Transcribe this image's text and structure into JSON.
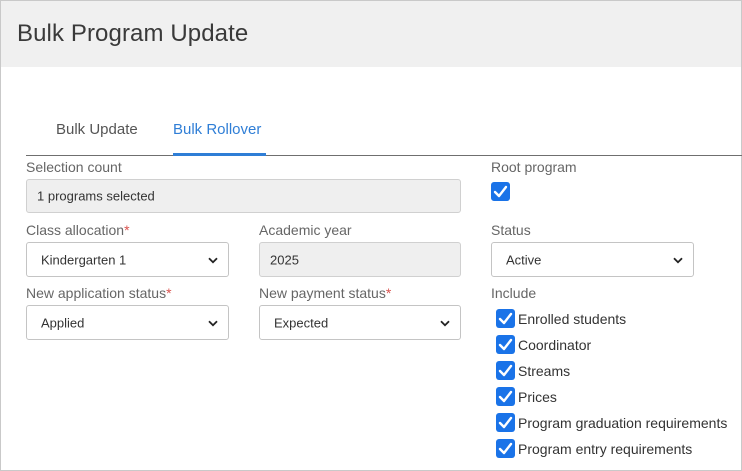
{
  "header": {
    "title": "Bulk Program Update"
  },
  "tabs": [
    {
      "label": "Bulk Update",
      "active": false
    },
    {
      "label": "Bulk Rollover",
      "active": true
    }
  ],
  "form": {
    "selection_count": {
      "label": "Selection count",
      "value": "1 programs selected"
    },
    "root_program": {
      "label": "Root program",
      "checked": true
    },
    "class_allocation": {
      "label": "Class allocation",
      "required_mark": "*",
      "value": "Kindergarten 1"
    },
    "academic_year": {
      "label": "Academic year",
      "value": "2025"
    },
    "status": {
      "label": "Status",
      "value": "Active"
    },
    "new_application_status": {
      "label": "New application status",
      "required_mark": "*",
      "value": "Applied"
    },
    "new_payment_status": {
      "label": "New payment status",
      "required_mark": "*",
      "value": "Expected"
    },
    "include": {
      "label": "Include",
      "options": [
        {
          "label": "Enrolled students",
          "checked": true
        },
        {
          "label": "Coordinator",
          "checked": true
        },
        {
          "label": "Streams",
          "checked": true
        },
        {
          "label": "Prices",
          "checked": true
        },
        {
          "label": "Program graduation requirements",
          "checked": true
        },
        {
          "label": "Program entry requirements",
          "checked": true
        }
      ]
    }
  },
  "colors": {
    "accent": "#2f7ed6",
    "checkbox": "#1a73e8",
    "header_bg": "#f0f0f0",
    "required": "#d9534f"
  }
}
